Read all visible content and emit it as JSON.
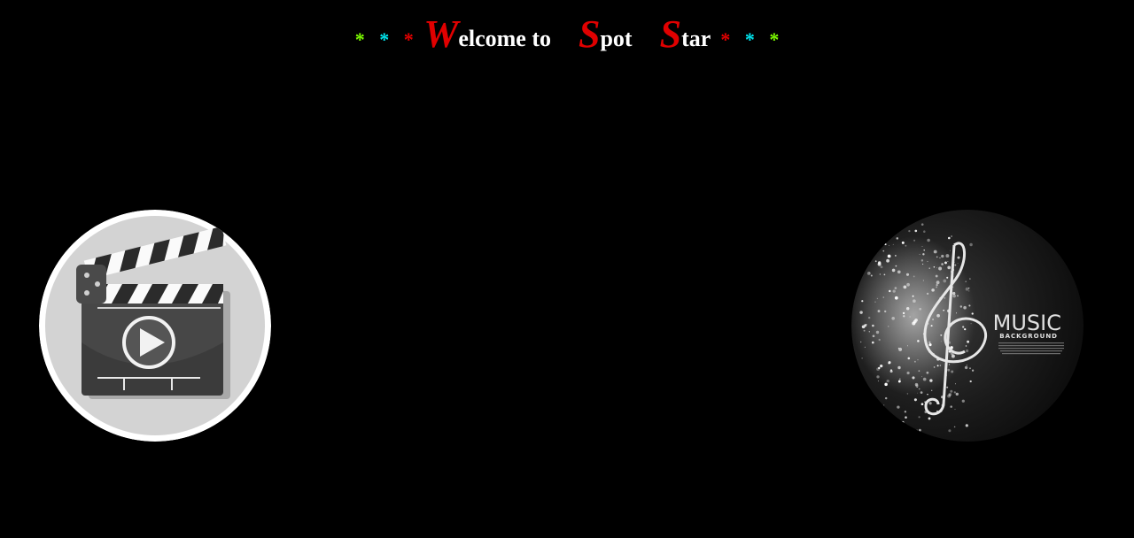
{
  "header": {
    "title_letter_1": "W",
    "title_rest_1": "elcome to",
    "title_letter_2": "S",
    "title_rest_2": "pot",
    "title_letter_3": "S",
    "title_rest_3": "tar",
    "star": "*"
  },
  "video_tile": {
    "icon": "clapperboard-play-icon"
  },
  "music_tile": {
    "icon": "treble-clef-icon",
    "heading": "MUSIC",
    "subheading": "BACKGROUND"
  },
  "colors": {
    "background": "#000000",
    "accent_red": "#e00000",
    "star_green": "#7cfc00",
    "star_cyan": "#00e5ee"
  }
}
